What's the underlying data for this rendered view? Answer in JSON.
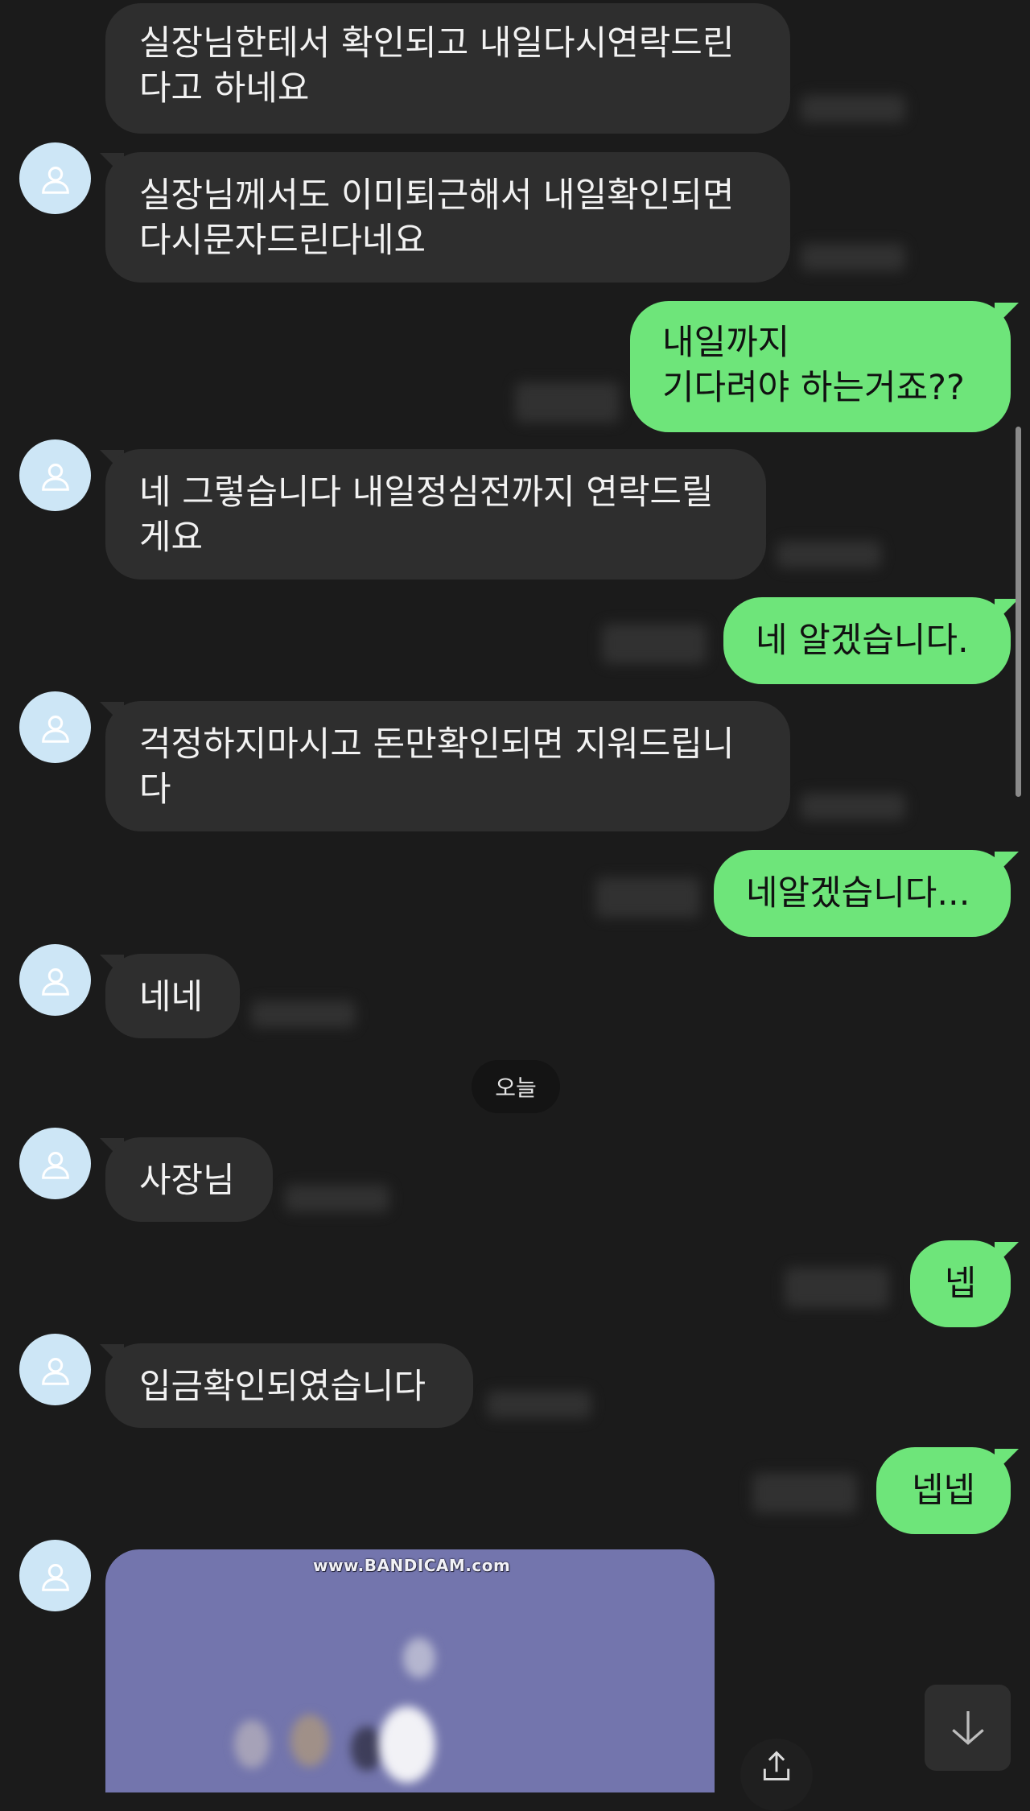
{
  "colors": {
    "background": "#1b1b1b",
    "incoming_bubble": "#2e2e2e",
    "outgoing_bubble": "#6ee57a",
    "avatar_bg": "#cde6f6",
    "image_bg": "#7375ad"
  },
  "date_separator": "오늘",
  "messages": [
    {
      "dir": "in",
      "text": "실장님한테서 확인되고 내일다시연락드린\n다고 하네요"
    },
    {
      "dir": "in",
      "text": "실장님께서도 이미퇴근해서 내일확인되면\n다시문자드린다네요"
    },
    {
      "dir": "out",
      "text": "내일까지\n기다려야 하는거죠??"
    },
    {
      "dir": "in",
      "text": "네 그렇습니다 내일정심전까지 연락드릴\n게요"
    },
    {
      "dir": "out",
      "text": "네 알겠습니다."
    },
    {
      "dir": "in",
      "text": "걱정하지마시고 돈만확인되면 지워드립니\n다"
    },
    {
      "dir": "out",
      "text": "네알겠습니다..."
    },
    {
      "dir": "in",
      "text": "네네"
    },
    {
      "dir": "in",
      "text": "사장님"
    },
    {
      "dir": "out",
      "text": "넵"
    },
    {
      "dir": "in",
      "text": "입금확인되였습니다"
    },
    {
      "dir": "out",
      "text": "넵넵"
    }
  ],
  "image_message": {
    "watermark": "www.BANDICAM.com"
  },
  "icons": {
    "avatar": "person-icon",
    "scroll_down": "arrow-down-icon",
    "share": "share-icon"
  }
}
